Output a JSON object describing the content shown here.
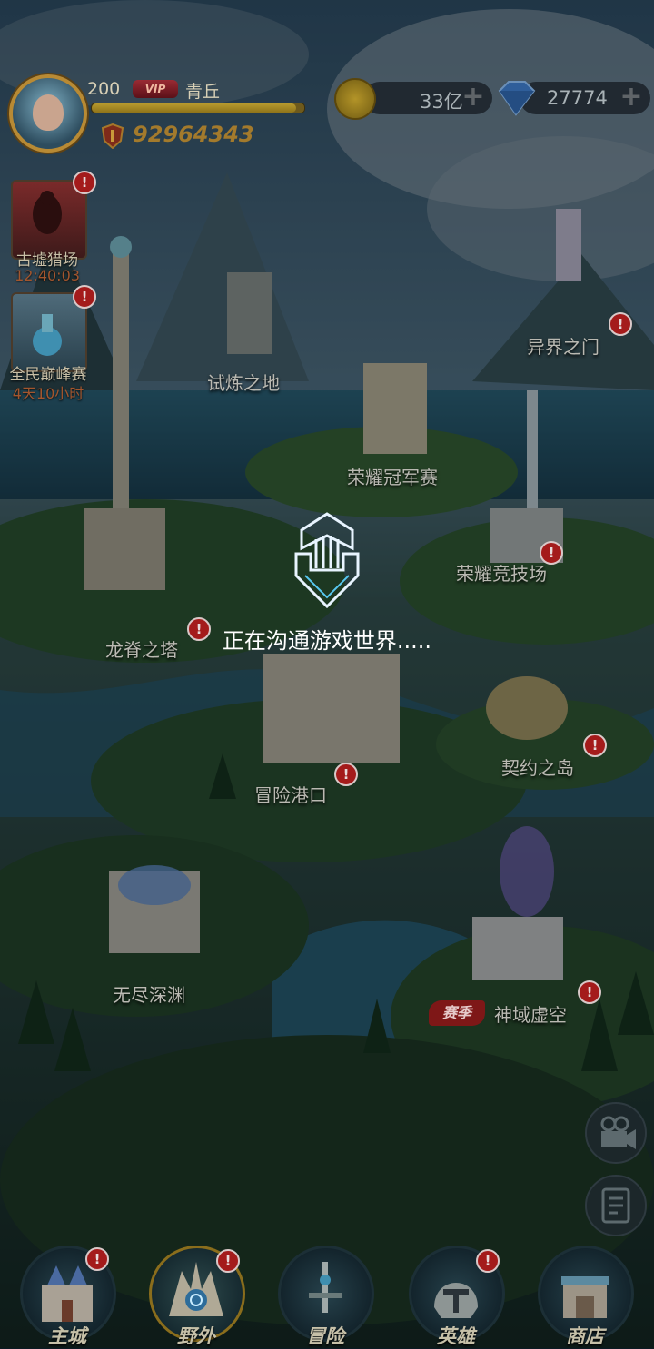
{
  "player": {
    "level": "200",
    "vip_text": "VIP",
    "name": "青丘",
    "exp_fraction": 0.96,
    "power": "92964343"
  },
  "resources": {
    "gold": "33亿",
    "diamonds": "27774",
    "plus": "+"
  },
  "events": [
    {
      "label": "古墟猎场",
      "timer": "12:40:03",
      "badge": "!"
    },
    {
      "label": "全民巅峰赛",
      "timer": "4天10小时",
      "badge": "!"
    }
  ],
  "locations": {
    "trial": "试炼之地",
    "other_world": "异界之门",
    "champion": "荣耀冠军赛",
    "arena": "荣耀竞技场",
    "dragon_tower": "龙脊之塔",
    "contract_isle": "契约之岛",
    "harbor": "冒险港口",
    "abyss": "无尽深渊",
    "void": "神域虚空",
    "season_tag": "赛季"
  },
  "badge_text": "!",
  "loading": {
    "text": "正在沟通游戏世界....."
  },
  "nav": [
    {
      "label": "主城",
      "icon": "castle-icon"
    },
    {
      "label": "野外",
      "icon": "wild-icon",
      "active": true
    },
    {
      "label": "冒险",
      "icon": "sword-icon"
    },
    {
      "label": "英雄",
      "icon": "helmet-icon"
    },
    {
      "label": "商店",
      "icon": "shop-icon"
    }
  ],
  "side_buttons": [
    "video-camera-icon",
    "notes-icon"
  ],
  "colors": {
    "badge_red": "#a41b1b",
    "gold": "#a37a2c",
    "loading_text": "#ffffff"
  }
}
